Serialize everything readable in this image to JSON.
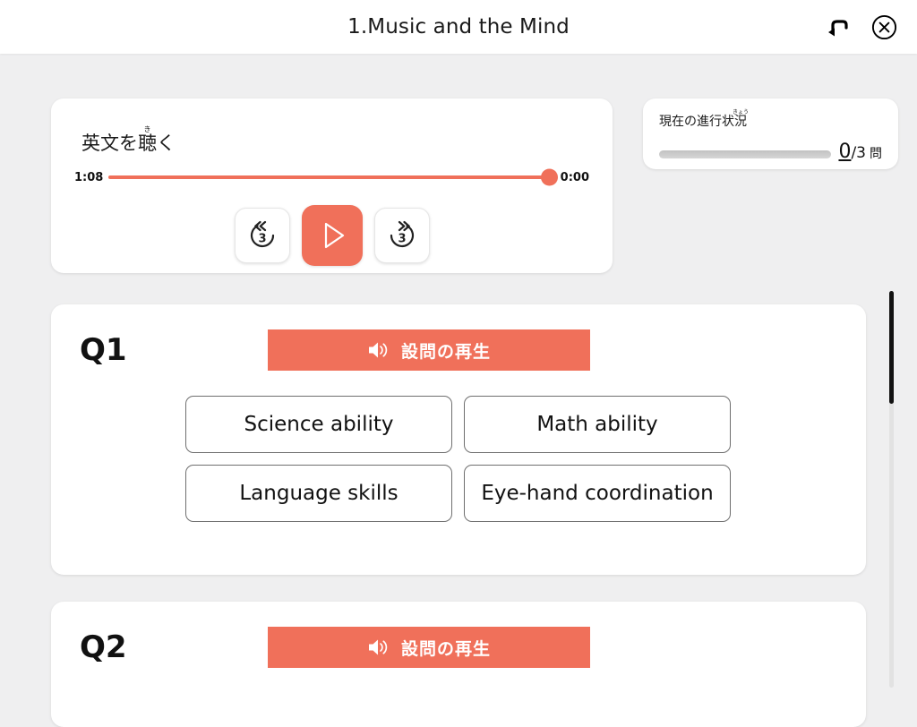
{
  "header": {
    "title": "1.Music and the Mind",
    "back_icon": "return-arrow-icon",
    "close_icon": "close-circle-icon"
  },
  "audio_player": {
    "title_base": "英文を",
    "title_ruby_base": "聴",
    "title_ruby_text": "き",
    "title_tail": "く",
    "elapsed_time": "1:08",
    "remaining_time": "0:00",
    "progress_percent": 100,
    "rewind_label": "3",
    "forward_label": "3",
    "rewind_icon": "rewind-3-seconds-icon",
    "play_icon": "play-icon",
    "forward_icon": "forward-3-seconds-icon"
  },
  "progress_status": {
    "title_base": "現在の進行状",
    "title_ruby_base": "況",
    "title_ruby_text": "きょう",
    "completed": "0",
    "separator": "/3",
    "unit": "問",
    "progress_percent": 0
  },
  "questions": [
    {
      "label": "Q1",
      "play_button_label": "設問の再生",
      "speaker_icon": "speaker-icon",
      "options": [
        "Science ability",
        "Math ability",
        "Language skills",
        "Eye-hand coordination"
      ]
    },
    {
      "label": "Q2",
      "play_button_label": "設問の再生",
      "speaker_icon": "speaker-icon",
      "options": []
    }
  ],
  "colors": {
    "accent": "#f0705a",
    "page_background": "#efeff0",
    "card_background": "#ffffff",
    "text": "#111111",
    "option_border": "#6f6f6f",
    "scrollbar_thumb": "#121212"
  }
}
